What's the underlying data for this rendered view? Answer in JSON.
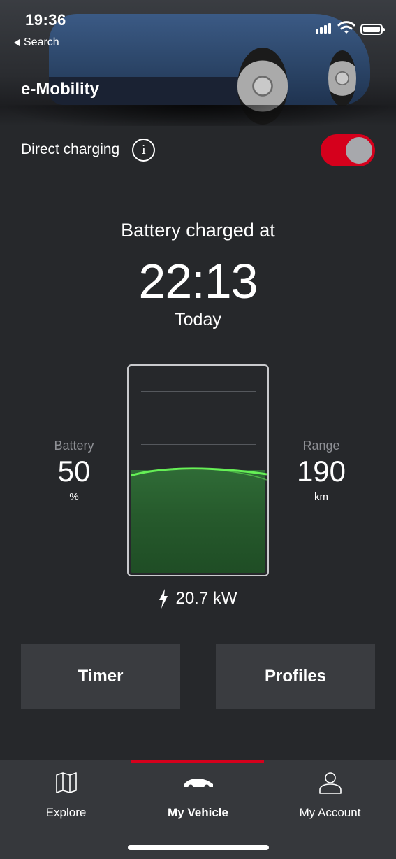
{
  "status_bar": {
    "time": "19:36",
    "back_label": "Search",
    "battery_icon": "battery-full-icon",
    "wifi_icon": "wifi-icon",
    "signal_icon": "cellular-signal-icon"
  },
  "header": {
    "title": "e-Mobility",
    "image": "vehicle-photo"
  },
  "direct_charging": {
    "label": "Direct charging",
    "info_icon": "info-icon",
    "info_glyph": "i",
    "toggle_on": true,
    "toggle_color": "#d5001c"
  },
  "charging_status": {
    "heading": "Battery charged at",
    "time": "22:13",
    "day": "Today"
  },
  "battery": {
    "label": "Battery",
    "value": "50",
    "unit": "%",
    "fill_fraction": 0.5,
    "fill_color": "#2f6b36",
    "wave_color": "#6bff5a"
  },
  "range": {
    "label": "Range",
    "value": "190",
    "unit": "km"
  },
  "power": {
    "icon": "lightning-bolt-icon",
    "value": "20.7 kW"
  },
  "actions": {
    "timer_label": "Timer",
    "profiles_label": "Profiles"
  },
  "tabbar": {
    "active_index": 1,
    "active_color": "#d5001c",
    "tabs": [
      {
        "label": "Explore",
        "icon": "map-icon"
      },
      {
        "label": "My Vehicle",
        "icon": "car-icon"
      },
      {
        "label": "My Account",
        "icon": "user-icon"
      }
    ]
  }
}
